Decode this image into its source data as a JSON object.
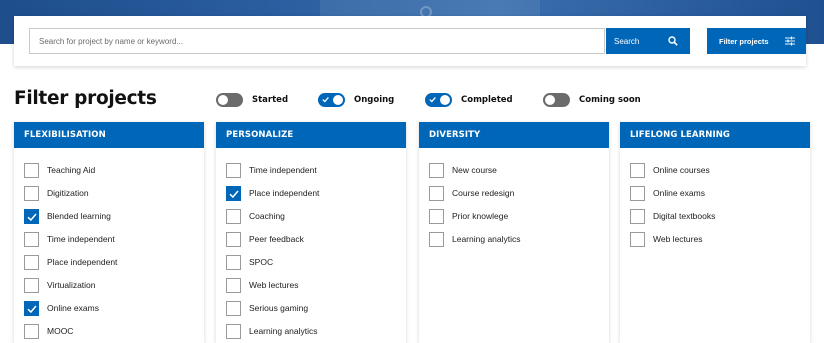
{
  "search": {
    "placeholder": "Search for project by name or keyword...",
    "button_label": "Search",
    "filter_button_label": "Filter projects"
  },
  "filters": {
    "heading": "Filter projects",
    "toggles": [
      {
        "label": "Started",
        "on": false
      },
      {
        "label": "Ongoing",
        "on": true
      },
      {
        "label": "Completed",
        "on": true
      },
      {
        "label": "Coming soon",
        "on": false
      }
    ]
  },
  "columns": [
    {
      "title": "FLEXIBILISATION",
      "options": [
        {
          "label": "Teaching Aid",
          "checked": false
        },
        {
          "label": "Digitization",
          "checked": false
        },
        {
          "label": "Blended learning",
          "checked": true
        },
        {
          "label": "Time independent",
          "checked": false
        },
        {
          "label": "Place independent",
          "checked": false
        },
        {
          "label": "Virtualization",
          "checked": false
        },
        {
          "label": "Online exams",
          "checked": true
        },
        {
          "label": "MOOC",
          "checked": false
        }
      ]
    },
    {
      "title": "PERSONALIZE",
      "options": [
        {
          "label": "Time independent",
          "checked": false
        },
        {
          "label": "Place independent",
          "checked": true
        },
        {
          "label": "Coaching",
          "checked": false
        },
        {
          "label": "Peer feedback",
          "checked": false
        },
        {
          "label": "SPOC",
          "checked": false
        },
        {
          "label": "Web lectures",
          "checked": false
        },
        {
          "label": "Serious gaming",
          "checked": false
        },
        {
          "label": "Learning analytics",
          "checked": false
        }
      ]
    },
    {
      "title": "DIVERSITY",
      "options": [
        {
          "label": "New course",
          "checked": false
        },
        {
          "label": "Course redesign",
          "checked": false
        },
        {
          "label": "Prior knowlege",
          "checked": false
        },
        {
          "label": "Learning analytics",
          "checked": false
        }
      ]
    },
    {
      "title": "LIFELONG LEARNING",
      "options": [
        {
          "label": "Online courses",
          "checked": false
        },
        {
          "label": "Online exams",
          "checked": false
        },
        {
          "label": "Digital textbooks",
          "checked": false
        },
        {
          "label": "Web lectures",
          "checked": false
        }
      ]
    }
  ],
  "colors": {
    "accent": "#0066b8",
    "toggle_off": "#6b6b6b"
  }
}
